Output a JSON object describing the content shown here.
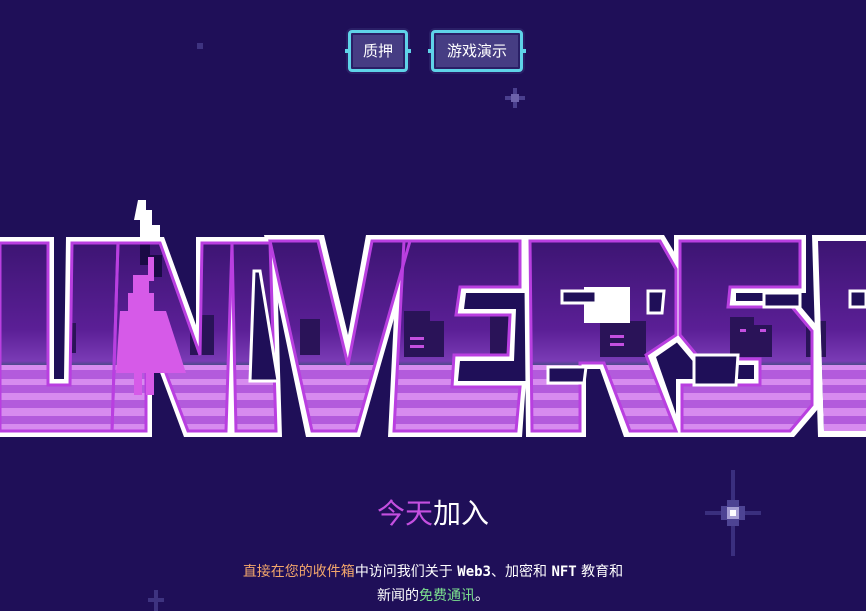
{
  "nav": {
    "stake_label": "质押",
    "demo_label": "游戏演示"
  },
  "logo": {
    "alt_text": "UNIVERSE"
  },
  "join": {
    "part1": "今天",
    "part2": "加入"
  },
  "description": {
    "highlight_orange": "直接在您的收件箱",
    "text1": "中访问我们关于 ",
    "web3": "Web3",
    "text2": "、加密和 ",
    "nft": "NFT",
    "text3": " 教育和",
    "text4": "新闻的",
    "highlight_green": "免费通讯",
    "text5": "。"
  },
  "colors": {
    "background": "#1f0f58",
    "accent_purple": "#c44fe0",
    "accent_orange": "#f2a66b",
    "accent_green": "#7ce08f",
    "button_border": "#5fd3e8"
  }
}
